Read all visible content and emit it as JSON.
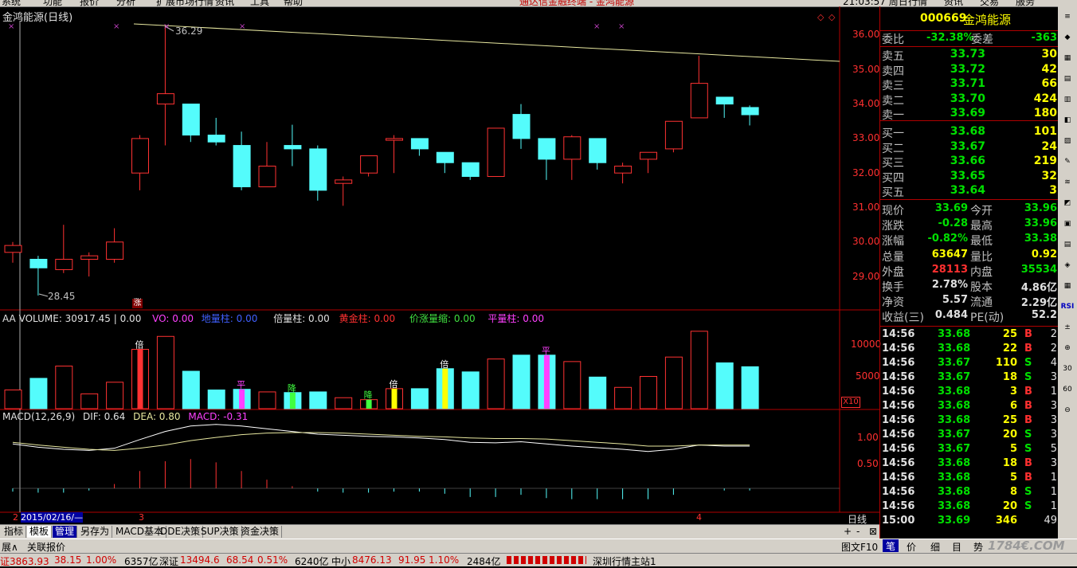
{
  "topbar": {
    "menus": [
      "系统",
      "功能",
      "报价",
      "分析",
      "扩展市场行情",
      "资讯",
      "工具",
      "帮助"
    ],
    "center_title": "通达信金融终端 - 金鸿能源",
    "time_day": "21:03:57 周日",
    "right_menus": [
      "行情",
      "资讯",
      "交易",
      "服务"
    ]
  },
  "chart": {
    "title": "金鸿能源(日线)",
    "high_label": "36.29",
    "low_label": "28.45",
    "price_axis": [
      "36.00",
      "35.00",
      "34.00",
      "33.00",
      "32.00",
      "31.00",
      "30.00",
      "29.00"
    ],
    "zhang_badge": "涨",
    "volume_header": {
      "main": "AA VOLUME: 30917.45 | 0.00",
      "vo": "VO: 0.00",
      "dilian": "地量柱: 0.00",
      "bei": "倍量柱: 0.00",
      "huangjin": "黄金柱: 0.00",
      "jiazhang": "价涨量缩: 0.00",
      "ping": "平量柱: 0.00"
    },
    "volume_axis": [
      "10000",
      "5000"
    ],
    "volume_unit": "X10",
    "macd_header": {
      "main": "MACD(12,26,9)",
      "dif": "DIF: 0.64",
      "dea": "DEA: 0.80",
      "macd": "MACD: -0.31"
    },
    "macd_axis": [
      "1.00",
      "0.50"
    ],
    "x_axis": {
      "date_label": "2015/02/16/—",
      "left_mark": "2",
      "month3": "3",
      "month4": "4",
      "period": "日线"
    },
    "vol_markers": [
      "倍",
      "平",
      "降",
      "降",
      "倍",
      "倍",
      "平"
    ],
    "chart_data": {
      "type": "candlestick",
      "candles": [
        {
          "o": 29.7,
          "c": 29.9,
          "h": 30.0,
          "l": 29.4
        },
        {
          "o": 29.5,
          "c": 29.25,
          "h": 29.6,
          "l": 28.45
        },
        {
          "o": 29.2,
          "c": 29.5,
          "h": 30.5,
          "l": 29.1
        },
        {
          "o": 29.5,
          "c": 29.6,
          "h": 29.7,
          "l": 29.0
        },
        {
          "o": 29.5,
          "c": 30.0,
          "h": 30.4,
          "l": 29.4
        },
        {
          "o": 32.0,
          "c": 33.0,
          "h": 33.1,
          "l": 31.5
        },
        {
          "o": 34.0,
          "c": 34.3,
          "h": 36.29,
          "l": 32.8
        },
        {
          "o": 34.0,
          "c": 33.1,
          "h": 34.0,
          "l": 32.9
        },
        {
          "o": 33.1,
          "c": 32.9,
          "h": 33.6,
          "l": 32.8
        },
        {
          "o": 32.8,
          "c": 31.6,
          "h": 33.2,
          "l": 31.5
        },
        {
          "o": 31.6,
          "c": 32.2,
          "h": 32.9,
          "l": 31.6
        },
        {
          "o": 32.8,
          "c": 32.7,
          "h": 33.4,
          "l": 32.2
        },
        {
          "o": 32.7,
          "c": 31.5,
          "h": 32.8,
          "l": 31.2
        },
        {
          "o": 31.7,
          "c": 31.8,
          "h": 31.9,
          "l": 31.05
        },
        {
          "o": 32.0,
          "c": 32.5,
          "h": 32.5,
          "l": 31.9
        },
        {
          "o": 32.95,
          "c": 33.0,
          "h": 33.1,
          "l": 32.0
        },
        {
          "o": 33.0,
          "c": 32.7,
          "h": 33.0,
          "l": 32.5
        },
        {
          "o": 32.6,
          "c": 32.3,
          "h": 32.6,
          "l": 32.0
        },
        {
          "o": 32.3,
          "c": 31.9,
          "h": 32.3,
          "l": 31.8
        },
        {
          "o": 31.9,
          "c": 33.3,
          "h": 33.3,
          "l": 31.9
        },
        {
          "o": 33.7,
          "c": 33.0,
          "h": 34.0,
          "l": 32.7
        },
        {
          "o": 33.0,
          "c": 32.4,
          "h": 33.0,
          "l": 31.8
        },
        {
          "o": 32.4,
          "c": 33.05,
          "h": 33.1,
          "l": 31.8
        },
        {
          "o": 33.0,
          "c": 32.3,
          "h": 33.0,
          "l": 32.1
        },
        {
          "o": 32.0,
          "c": 32.2,
          "h": 32.3,
          "l": 31.7
        },
        {
          "o": 32.4,
          "c": 32.6,
          "h": 32.6,
          "l": 32.0
        },
        {
          "o": 32.7,
          "c": 33.5,
          "h": 33.5,
          "l": 32.6
        },
        {
          "o": 33.6,
          "c": 34.6,
          "h": 35.4,
          "l": 33.6
        },
        {
          "o": 34.2,
          "c": 34.0,
          "h": 34.2,
          "l": 33.6
        },
        {
          "o": 33.9,
          "c": 33.69,
          "h": 33.96,
          "l": 33.38
        }
      ],
      "volumes": [
        2900,
        4700,
        6600,
        2300,
        4100,
        9200,
        11200,
        5800,
        2900,
        3000,
        2600,
        2500,
        2600,
        1700,
        1400,
        3100,
        3100,
        6200,
        5700,
        7700,
        8300,
        8300,
        7300,
        4900,
        3300,
        5000,
        8000,
        12000,
        7100,
        6500
      ],
      "dif": [
        0.82,
        0.76,
        0.72,
        0.7,
        0.74,
        0.9,
        1.05,
        1.15,
        1.18,
        1.15,
        1.1,
        1.05,
        1.0,
        0.98,
        0.96,
        0.95,
        0.93,
        0.9,
        0.85,
        0.84,
        0.86,
        0.82,
        0.78,
        0.75,
        0.72,
        0.68,
        0.72,
        0.8,
        0.78,
        0.78
      ],
      "dea": [
        0.85,
        0.8,
        0.76,
        0.72,
        0.7,
        0.74,
        0.8,
        0.88,
        0.94,
        0.99,
        1.02,
        1.03,
        1.03,
        1.02,
        1.0,
        0.98,
        0.96,
        0.95,
        0.93,
        0.92,
        0.92,
        0.91,
        0.88,
        0.85,
        0.82,
        0.78,
        0.78,
        0.8,
        0.8,
        0.8
      ],
      "macd_bars": [
        -0.06,
        -0.08,
        -0.08,
        -0.04,
        0.08,
        0.32,
        0.5,
        0.54,
        0.48,
        0.32,
        0.16,
        0.04,
        -0.06,
        -0.08,
        -0.08,
        -0.06,
        -0.06,
        -0.1,
        -0.16,
        -0.16,
        -0.12,
        -0.18,
        -0.2,
        -0.2,
        -0.2,
        -0.2,
        -0.12,
        0.0,
        -0.04,
        -0.04
      ]
    }
  },
  "quote": {
    "code": "000669",
    "name": "金鸿能源",
    "weibi_label": "委比",
    "weibi": "-32.38%",
    "weicha_label": "委差",
    "weicha": "-363",
    "asks": [
      {
        "label": "卖五",
        "price": "33.73",
        "vol": "30"
      },
      {
        "label": "卖四",
        "price": "33.72",
        "vol": "42"
      },
      {
        "label": "卖三",
        "price": "33.71",
        "vol": "66"
      },
      {
        "label": "卖二",
        "price": "33.70",
        "vol": "424"
      },
      {
        "label": "卖一",
        "price": "33.69",
        "vol": "180"
      }
    ],
    "bids": [
      {
        "label": "买一",
        "price": "33.68",
        "vol": "101"
      },
      {
        "label": "买二",
        "price": "33.67",
        "vol": "24"
      },
      {
        "label": "买三",
        "price": "33.66",
        "vol": "219"
      },
      {
        "label": "买四",
        "price": "33.65",
        "vol": "32"
      },
      {
        "label": "买五",
        "price": "33.64",
        "vol": "3"
      }
    ],
    "info": [
      {
        "l1": "现价",
        "v1": "33.69",
        "c1": "#00e000",
        "l2": "今开",
        "v2": "33.96",
        "c2": "#00e000"
      },
      {
        "l1": "涨跌",
        "v1": "-0.28",
        "c1": "#00e000",
        "l2": "最高",
        "v2": "33.96",
        "c2": "#00e000"
      },
      {
        "l1": "涨幅",
        "v1": "-0.82%",
        "c1": "#00e000",
        "l2": "最低",
        "v2": "33.38",
        "c2": "#00e000"
      },
      {
        "l1": "总量",
        "v1": "63647",
        "c1": "#ffff00",
        "l2": "量比",
        "v2": "0.92",
        "c2": "#ffff00"
      },
      {
        "l1": "外盘",
        "v1": "28113",
        "c1": "#ff3030",
        "l2": "内盘",
        "v2": "35534",
        "c2": "#00e000"
      },
      {
        "l1": "换手",
        "v1": "2.78%",
        "c1": "#e0e0e0",
        "l2": "股本",
        "v2": "4.86亿",
        "c2": "#e0e0e0"
      },
      {
        "l1": "净资",
        "v1": "5.57",
        "c1": "#e0e0e0",
        "l2": "流通",
        "v2": "2.29亿",
        "c2": "#e0e0e0"
      },
      {
        "l1": "收益(三)",
        "v1": "0.484",
        "c1": "#e0e0e0",
        "l2": "PE(动)",
        "v2": "52.2",
        "c2": "#e0e0e0"
      }
    ],
    "ticks": [
      {
        "t": "14:56",
        "p": "33.68",
        "v": "25",
        "d": "B",
        "n": "2"
      },
      {
        "t": "14:56",
        "p": "33.68",
        "v": "22",
        "d": "B",
        "n": "2"
      },
      {
        "t": "14:56",
        "p": "33.67",
        "v": "110",
        "d": "S",
        "n": "4"
      },
      {
        "t": "14:56",
        "p": "33.67",
        "v": "18",
        "d": "S",
        "n": "3"
      },
      {
        "t": "14:56",
        "p": "33.68",
        "v": "3",
        "d": "B",
        "n": "1"
      },
      {
        "t": "14:56",
        "p": "33.68",
        "v": "6",
        "d": "B",
        "n": "3"
      },
      {
        "t": "14:56",
        "p": "33.68",
        "v": "25",
        "d": "B",
        "n": "3"
      },
      {
        "t": "14:56",
        "p": "33.67",
        "v": "20",
        "d": "S",
        "n": "3"
      },
      {
        "t": "14:56",
        "p": "33.67",
        "v": "5",
        "d": "S",
        "n": "5"
      },
      {
        "t": "14:56",
        "p": "33.68",
        "v": "18",
        "d": "B",
        "n": "3"
      },
      {
        "t": "14:56",
        "p": "33.68",
        "v": "5",
        "d": "B",
        "n": "1"
      },
      {
        "t": "14:56",
        "p": "33.68",
        "v": "8",
        "d": "S",
        "n": "1"
      },
      {
        "t": "14:56",
        "p": "33.68",
        "v": "20",
        "d": "S",
        "n": "1"
      },
      {
        "t": "15:00",
        "p": "33.69",
        "v": "346",
        "d": "",
        "n": "49"
      }
    ]
  },
  "bottom_tabs": [
    "指标",
    "模板",
    "管理",
    "另存为",
    "MACD基本",
    "DDE决策",
    "SUP决策",
    "资金决策"
  ],
  "bottom_controls": [
    "+",
    "-",
    "⊠"
  ],
  "row2": {
    "left1": "展∧",
    "left2": "关联报价",
    "right_label": "图文F10",
    "right_tabs": [
      "笔",
      "价",
      "细",
      "目",
      "势"
    ],
    "watermark": "1784€.COM"
  },
  "status": {
    "sh": "证3863.93",
    "sh_chg": "38.15",
    "sh_pct": "1.00%",
    "sh_amt": "6357亿",
    "sz_label": "深证",
    "sz": "13494.6",
    "sz_chg": "68.54",
    "sz_pct": "0.51%",
    "sz_amt": "6240亿",
    "zx_label": "中小",
    "zx": "8476.13",
    "zx_chg": "91.95",
    "zx_pct": "1.10%",
    "zx_amt": "2484亿",
    "server": "深圳行情主站1"
  },
  "toolbar": [
    "≡",
    "◆",
    "▦",
    "▤",
    "▥",
    "◧",
    "▨",
    "✎",
    "≋",
    "◩",
    "▣",
    "▤",
    "◈",
    "▦",
    "RSI",
    "±",
    "⊕",
    "30",
    "60",
    "⊖"
  ]
}
